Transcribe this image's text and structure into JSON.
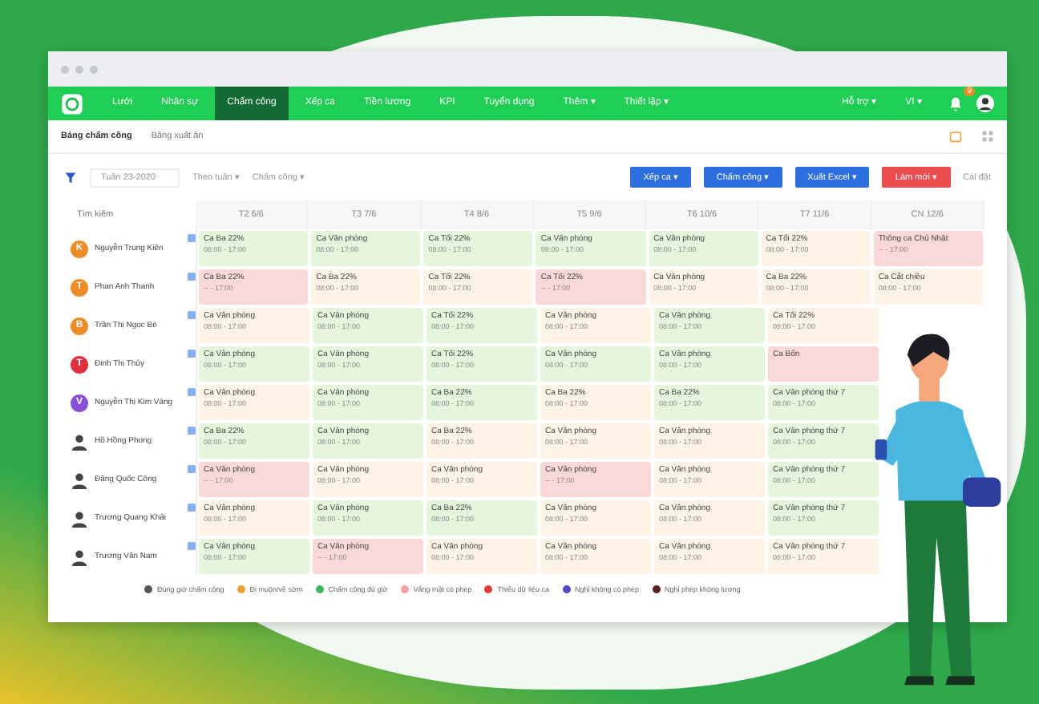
{
  "nav": {
    "items": [
      {
        "label": "Lưới",
        "selected": false
      },
      {
        "label": "Nhân sự",
        "selected": false
      },
      {
        "label": "Chấm công",
        "selected": true
      },
      {
        "label": "Xếp ca",
        "selected": false
      },
      {
        "label": "Tiền lương",
        "selected": false
      },
      {
        "label": "KPI",
        "selected": false
      },
      {
        "label": "Tuyển dụng",
        "selected": false
      },
      {
        "label": "Thêm ▾",
        "selected": false
      },
      {
        "label": "Thiết lập ▾",
        "selected": false
      }
    ],
    "right": [
      "Hỗ trợ ▾",
      "VI ▾"
    ],
    "badge": "9"
  },
  "tabs": [
    {
      "label": "Bảng chấm công",
      "selected": true
    },
    {
      "label": "Bảng xuất ăn",
      "selected": false
    }
  ],
  "toolbar": {
    "week": "Tuần 23-2020",
    "filters": [
      "Theo tuần ▾",
      "Chấm công ▾"
    ],
    "buttons": [
      {
        "label": "Xếp ca ▾",
        "kind": "primary"
      },
      {
        "label": "Chấm công ▾",
        "kind": "primary"
      },
      {
        "label": "Xuất Excel ▾",
        "kind": "primary"
      },
      {
        "label": "Làm mới ▾",
        "kind": "danger"
      }
    ],
    "settings": "Cài đặt"
  },
  "table": {
    "search": {
      "placeholder": "Tìm kiếm"
    },
    "columns": [
      "T2 6/6",
      "T3 7/6",
      "T4 8/6",
      "T5 9/6",
      "T6 10/6",
      "T7 11/6",
      "CN 12/6"
    ],
    "rows": [
      {
        "name": "Nguyễn Trung Kiên",
        "avatar": {
          "kind": "initial",
          "text": "K",
          "color": "#f08a24"
        },
        "cells": [
          {
            "shift": "Ca Ba 22%",
            "time": "08:00 - 17:00",
            "color": "#e5f6dd"
          },
          {
            "shift": "Ca Văn phòng",
            "time": "08:00 - 17:00",
            "color": "#e5f6dd"
          },
          {
            "shift": "Ca Tối 22%",
            "time": "08:00 - 17:00",
            "color": "#e5f6dd"
          },
          {
            "shift": "Ca Văn phòng",
            "time": "08:00 - 17:00",
            "color": "#e5f6dd"
          },
          {
            "shift": "Ca Văn phòng",
            "time": "08:00 - 17:00",
            "color": "#e5f6dd"
          },
          {
            "shift": "Ca Tối 22%",
            "time": "08:00 - 17:00",
            "color": "#fff3e6"
          },
          {
            "shift": "Thông ca Chủ Nhật",
            "time": "-- - 17:00",
            "color": "#fbd9d9"
          }
        ]
      },
      {
        "name": "Phan Anh Thanh",
        "avatar": {
          "kind": "initial",
          "text": "T",
          "color": "#f08a24"
        },
        "cells": [
          {
            "shift": "Ca Ba 22%",
            "time": "-- - 17:00",
            "color": "#fbd9d9"
          },
          {
            "shift": "Ca Ba 22%",
            "time": "08:00 - 17:00",
            "color": "#fff3e6"
          },
          {
            "shift": "Ca Tối 22%",
            "time": "08:00 - 17:00",
            "color": "#fff3e6"
          },
          {
            "shift": "Ca Tối 22%",
            "time": "-- - 17:00",
            "color": "#fbd9d9"
          },
          {
            "shift": "Ca Văn phòng",
            "time": "08:00 - 17:00",
            "color": "#fff3e6"
          },
          {
            "shift": "Ca Ba 22%",
            "time": "08:00 - 17:00",
            "color": "#fff3e6"
          },
          {
            "shift": "Ca Cắt chiều",
            "time": "08:00 - 17:00",
            "color": "#fff3e6"
          }
        ]
      },
      {
        "name": "Trần Thị Ngọc Bé",
        "avatar": {
          "kind": "initial",
          "text": "B",
          "color": "#f08a24"
        },
        "cells": [
          {
            "shift": "Ca Văn phòng",
            "time": "08:00 - 17:00",
            "color": "#fff3e6"
          },
          {
            "shift": "Ca Văn phòng",
            "time": "08:00 - 17:00",
            "color": "#e5f6dd"
          },
          {
            "shift": "Ca Tối 22%",
            "time": "08:00 - 17:00",
            "color": "#e5f6dd"
          },
          {
            "shift": "Ca Văn phòng",
            "time": "08:00 - 17:00",
            "color": "#fff3e6"
          },
          {
            "shift": "Ca Văn phòng",
            "time": "08:00 - 17:00",
            "color": "#e5f6dd"
          },
          {
            "shift": "Ca Tối 22%",
            "time": "08:00 - 17:00",
            "color": "#fff3e6"
          }
        ]
      },
      {
        "name": "Đinh Thị Thủy",
        "avatar": {
          "kind": "initial",
          "text": "T",
          "color": "#e0303c"
        },
        "cells": [
          {
            "shift": "Ca Văn phòng",
            "time": "08:00 - 17:00",
            "color": "#e5f6dd"
          },
          {
            "shift": "Ca Văn phòng",
            "time": "08:00 - 17:00",
            "color": "#e5f6dd"
          },
          {
            "shift": "Ca Tối 22%",
            "time": "08:00 - 17:00",
            "color": "#e5f6dd"
          },
          {
            "shift": "Ca Văn phòng",
            "time": "08:00 - 17:00",
            "color": "#e5f6dd"
          },
          {
            "shift": "Ca Văn phòng",
            "time": "08:00 - 17:00",
            "color": "#e5f6dd"
          },
          {
            "shift": "Ca Bốn",
            "color": "#fbd9d9"
          }
        ]
      },
      {
        "name": "Nguyễn Thị Kim Vàng",
        "avatar": {
          "kind": "initial",
          "text": "V",
          "color": "#8a4fd8"
        },
        "cells": [
          {
            "shift": "Ca Văn phòng",
            "time": "08:00 - 17:00",
            "color": "#fff3e6"
          },
          {
            "shift": "Ca Văn phòng",
            "time": "08:00 - 17:00",
            "color": "#e5f6dd"
          },
          {
            "shift": "Ca Ba 22%",
            "time": "08:00 - 17:00",
            "color": "#e5f6dd"
          },
          {
            "shift": "Ca Ba 22%",
            "time": "08:00 - 17:00",
            "color": "#fff3e6"
          },
          {
            "shift": "Ca Ba 22%",
            "time": "08:00 - 17:00",
            "color": "#e5f6dd"
          },
          {
            "shift": "Ca Văn phòng thứ 7",
            "time": "08:00 - 17:00",
            "color": "#e5f6dd"
          }
        ]
      },
      {
        "name": "Hồ Hồng Phong",
        "avatar": {
          "kind": "photo"
        },
        "cells": [
          {
            "shift": "Ca Ba 22%",
            "time": "08:00 - 17:00",
            "color": "#e5f6dd"
          },
          {
            "shift": "Ca Văn phòng",
            "time": "08:00 - 17:00",
            "color": "#e5f6dd"
          },
          {
            "shift": "Ca Ba 22%",
            "time": "08:00 - 17:00",
            "color": "#fff3e6"
          },
          {
            "shift": "Ca Văn phòng",
            "time": "08:00 - 17:00",
            "color": "#fff3e6"
          },
          {
            "shift": "Ca Văn phòng",
            "time": "08:00 - 17:00",
            "color": "#fff3e6"
          },
          {
            "shift": "Ca Văn phòng thứ 7",
            "time": "08:00 - 17:00",
            "color": "#e5f6dd"
          }
        ]
      },
      {
        "name": "Đặng Quốc Công",
        "avatar": {
          "kind": "photo"
        },
        "cells": [
          {
            "shift": "Ca Văn phòng",
            "time": "-- - 17:00",
            "color": "#fbd9d9"
          },
          {
            "shift": "Ca Văn phòng",
            "time": "08:00 - 17:00",
            "color": "#fff3e6"
          },
          {
            "shift": "Ca Văn phòng",
            "time": "08:00 - 17:00",
            "color": "#fff3e6"
          },
          {
            "shift": "Ca Văn phòng",
            "time": "-- - 17:00",
            "color": "#fbd9d9"
          },
          {
            "shift": "Ca Văn phòng",
            "time": "08:00 - 17:00",
            "color": "#fff3e6"
          },
          {
            "shift": "Ca Văn phòng thứ 7",
            "time": "08:00 - 17:00",
            "color": "#e5f6dd"
          }
        ]
      },
      {
        "name": "Trương Quang Khải",
        "avatar": {
          "kind": "photo"
        },
        "cells": [
          {
            "shift": "Ca Văn phòng",
            "time": "08:00 - 17:00",
            "color": "#fff3e6"
          },
          {
            "shift": "Ca Văn phòng",
            "time": "08:00 - 17:00",
            "color": "#e5f6dd"
          },
          {
            "shift": "Ca Ba 22%",
            "time": "08:00 - 17:00",
            "color": "#e5f6dd"
          },
          {
            "shift": "Ca Văn phòng",
            "time": "08:00 - 17:00",
            "color": "#fff3e6"
          },
          {
            "shift": "Ca Văn phòng",
            "time": "08:00 - 17:00",
            "color": "#fff3e6"
          },
          {
            "shift": "Ca Văn phòng thứ 7",
            "time": "08:00 - 17:00",
            "color": "#e5f6dd"
          }
        ]
      },
      {
        "name": "Trương Văn Nam",
        "avatar": {
          "kind": "photo"
        },
        "cells": [
          {
            "shift": "Ca Văn phòng",
            "time": "08:00 - 17:00",
            "color": "#e5f6dd"
          },
          {
            "shift": "Ca Văn phòng",
            "time": "-- - 17:00",
            "color": "#fbd9d9"
          },
          {
            "shift": "Ca Văn phòng",
            "time": "08:00 - 17:00",
            "color": "#fff3e6"
          },
          {
            "shift": "Ca Văn phòng",
            "time": "08:00 - 17:00",
            "color": "#fff3e6"
          },
          {
            "shift": "Ca Văn phòng",
            "time": "08:00 - 17:00",
            "color": "#fff3e6"
          },
          {
            "shift": "Ca Văn phòng thứ 7",
            "time": "08:00 - 17:00",
            "color": "#fff3e6"
          }
        ]
      }
    ]
  },
  "legend": [
    {
      "label": "Đúng giờ chấm công",
      "color": "#555555"
    },
    {
      "label": "Đi muộn/về sớm",
      "color": "#f0a030"
    },
    {
      "label": "Chấm công đủ giờ",
      "color": "#3cb85c"
    },
    {
      "label": "Vắng mặt có phép",
      "color": "#f5a0a0"
    },
    {
      "label": "Thiếu dữ liệu ca",
      "color": "#e53935"
    },
    {
      "label": "Nghỉ không có phép",
      "color": "#5048c8"
    },
    {
      "label": "Nghỉ phép không lương",
      "color": "#5a2020"
    }
  ]
}
